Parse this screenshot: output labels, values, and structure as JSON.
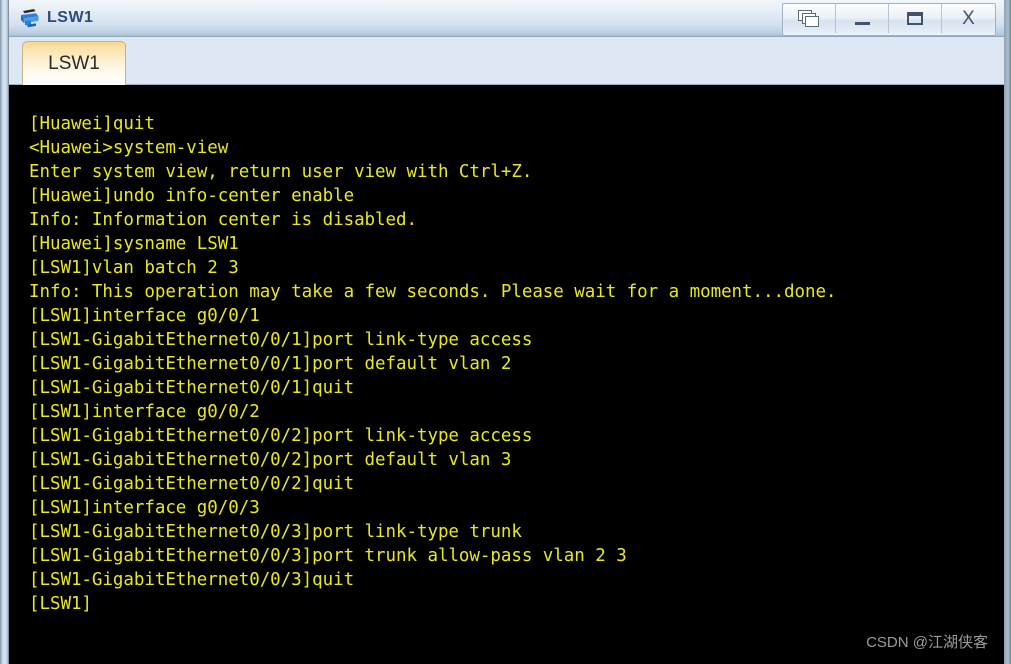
{
  "window": {
    "title": "LSW1",
    "icon": "switch-device-icon",
    "controls": [
      {
        "name": "cascade-windows-button",
        "label": "",
        "glyph": "cascade"
      },
      {
        "name": "minimize-button",
        "label": "",
        "glyph": "minimize"
      },
      {
        "name": "maximize-button",
        "label": "",
        "glyph": "maximize"
      },
      {
        "name": "close-button",
        "label": "X",
        "glyph": "close"
      }
    ]
  },
  "tabs": [
    {
      "label": "LSW1",
      "active": true
    }
  ],
  "terminal": {
    "background_color": "#000000",
    "text_color": "#e8e81c",
    "lines": [
      "[Huawei]quit",
      "<Huawei>system-view",
      "Enter system view, return user view with Ctrl+Z.",
      "[Huawei]undo info-center enable",
      "Info: Information center is disabled.",
      "[Huawei]sysname LSW1",
      "[LSW1]vlan batch 2 3",
      "Info: This operation may take a few seconds. Please wait for a moment...done.",
      "[LSW1]interface g0/0/1",
      "[LSW1-GigabitEthernet0/0/1]port link-type access",
      "[LSW1-GigabitEthernet0/0/1]port default vlan 2",
      "[LSW1-GigabitEthernet0/0/1]quit",
      "[LSW1]interface g0/0/2",
      "[LSW1-GigabitEthernet0/0/2]port link-type access",
      "[LSW1-GigabitEthernet0/0/2]port default vlan 3",
      "[LSW1-GigabitEthernet0/0/2]quit",
      "[LSW1]interface g0/0/3",
      "[LSW1-GigabitEthernet0/0/3]port link-type trunk",
      "[LSW1-GigabitEthernet0/0/3]port trunk allow-pass vlan 2 3",
      "[LSW1-GigabitEthernet0/0/3]quit",
      "[LSW1]"
    ]
  },
  "watermark": {
    "text": "CSDN @江湖侠客",
    "color": "#9b9b9b"
  }
}
